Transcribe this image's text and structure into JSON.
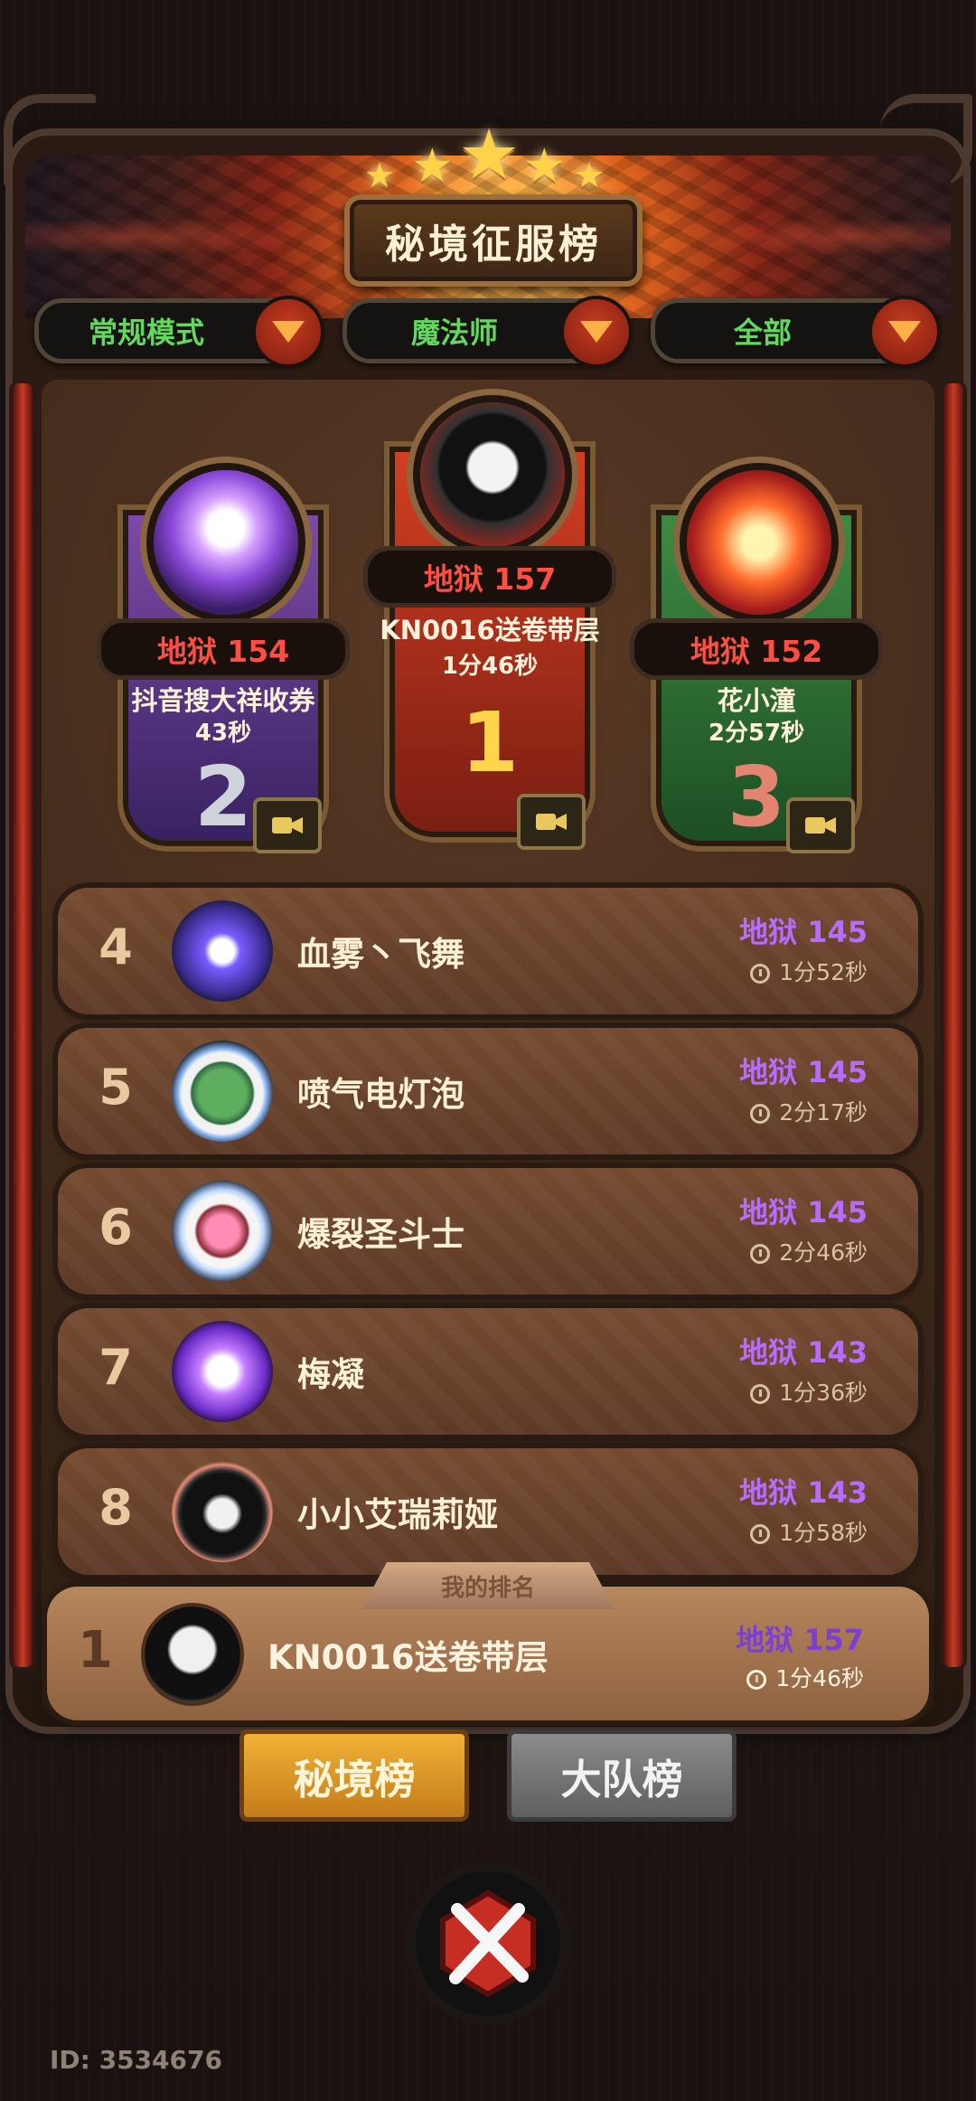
{
  "title": "秘境征服榜",
  "filters": [
    {
      "label": "常规模式"
    },
    {
      "label": "魔法师"
    },
    {
      "label": "全部"
    }
  ],
  "podium": [
    {
      "rank": "2",
      "mode": "地狱 154",
      "name": "抖音搜大祥收券",
      "time": "43秒",
      "color": "#6d49a8"
    },
    {
      "rank": "1",
      "mode": "地狱 157",
      "name": "KN0016送卷带层",
      "time": "1分46秒",
      "color": "#c93f24"
    },
    {
      "rank": "3",
      "mode": "地狱 152",
      "name": "花小潼",
      "time": "2分57秒",
      "color": "#3f8b43"
    }
  ],
  "rows": [
    {
      "rank": "4",
      "name": "血雾丶飞舞",
      "score": "地狱 145",
      "time": "1分52秒",
      "avatar": "moon-avatar"
    },
    {
      "rank": "5",
      "name": "喷气电灯泡",
      "score": "地狱 145",
      "time": "2分17秒",
      "avatar": "astronaut-frog-avatar"
    },
    {
      "rank": "6",
      "name": "爆裂圣斗士",
      "score": "地狱 145",
      "time": "2分46秒",
      "avatar": "astronaut-cow-avatar"
    },
    {
      "rank": "7",
      "name": "梅凝",
      "score": "地狱 143",
      "time": "1分36秒",
      "avatar": "purple-dragon-avatar"
    },
    {
      "rank": "8",
      "name": "小小艾瑞莉娅",
      "score": "地狱 143",
      "time": "1分58秒",
      "avatar": "flower-hat-avatar"
    }
  ],
  "my_rank": {
    "label": "我的排名",
    "rank": "1",
    "name": "KN0016送卷带层",
    "score": "地狱 157",
    "time": "1分46秒"
  },
  "tabs": [
    {
      "label": "秘境榜"
    },
    {
      "label": "大队榜"
    }
  ],
  "id_text": "ID: 3534676",
  "colors": {
    "filter_text": "#62d95c",
    "score_purple": "#b86cff",
    "hell_red": "#ff4f42",
    "active_tab": "#f2b137"
  }
}
